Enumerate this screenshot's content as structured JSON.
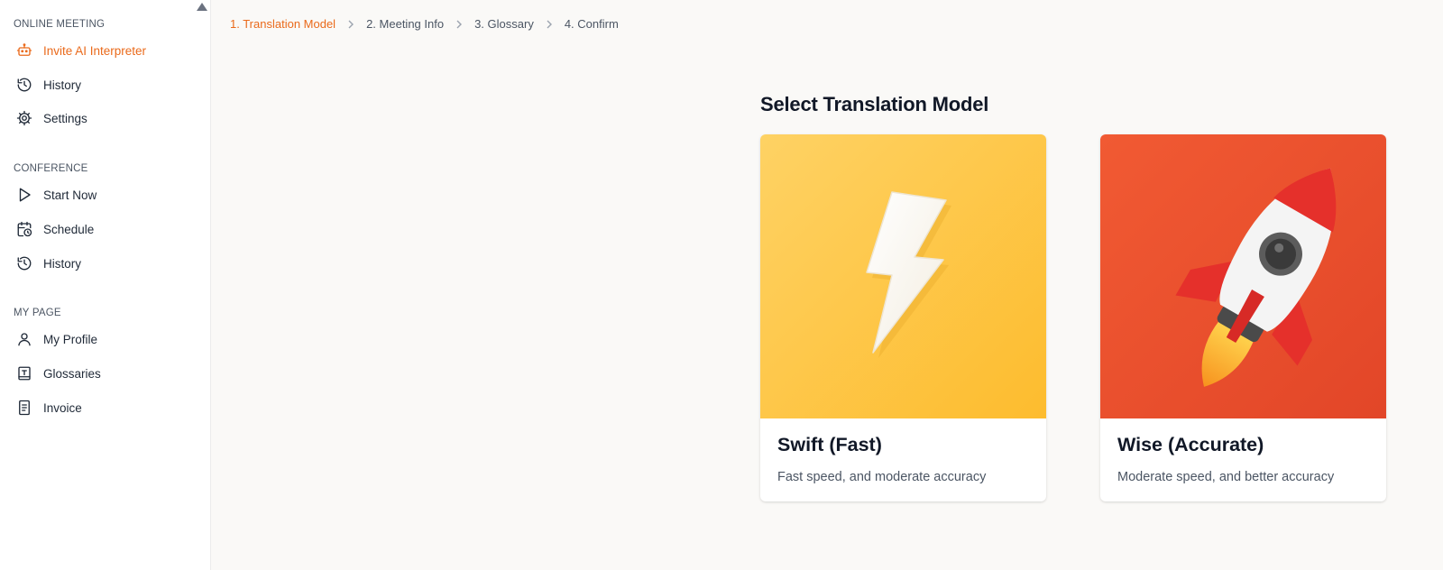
{
  "sidebar": {
    "sections": [
      {
        "title": "ONLINE MEETING",
        "items": [
          {
            "label": "Invite AI Interpreter",
            "icon": "robot-icon",
            "active": true
          },
          {
            "label": "History",
            "icon": "history-icon"
          },
          {
            "label": "Settings",
            "icon": "gear-icon"
          }
        ]
      },
      {
        "title": "CONFERENCE",
        "items": [
          {
            "label": "Start Now",
            "icon": "play-icon"
          },
          {
            "label": "Schedule",
            "icon": "calendar-clock-icon"
          },
          {
            "label": "History",
            "icon": "history-icon"
          }
        ]
      },
      {
        "title": "MY PAGE",
        "items": [
          {
            "label": "My Profile",
            "icon": "user-icon"
          },
          {
            "label": "Glossaries",
            "icon": "book-icon"
          },
          {
            "label": "Invoice",
            "icon": "invoice-icon"
          }
        ]
      }
    ]
  },
  "steps": [
    {
      "label": "1. Translation Model",
      "active": true
    },
    {
      "label": "2. Meeting Info"
    },
    {
      "label": "3. Glossary"
    },
    {
      "label": "4. Confirm"
    }
  ],
  "main": {
    "heading": "Select Translation Model",
    "cards": [
      {
        "title": "Swift (Fast)",
        "description": "Fast speed, and moderate accuracy",
        "icon": "lightning-bolt-icon",
        "color": "#fdc23c"
      },
      {
        "title": "Wise (Accurate)",
        "description": "Moderate speed, and better accuracy",
        "icon": "rocket-icon",
        "color": "#ec5530"
      }
    ]
  },
  "colors": {
    "accent": "#ea6a1b"
  }
}
